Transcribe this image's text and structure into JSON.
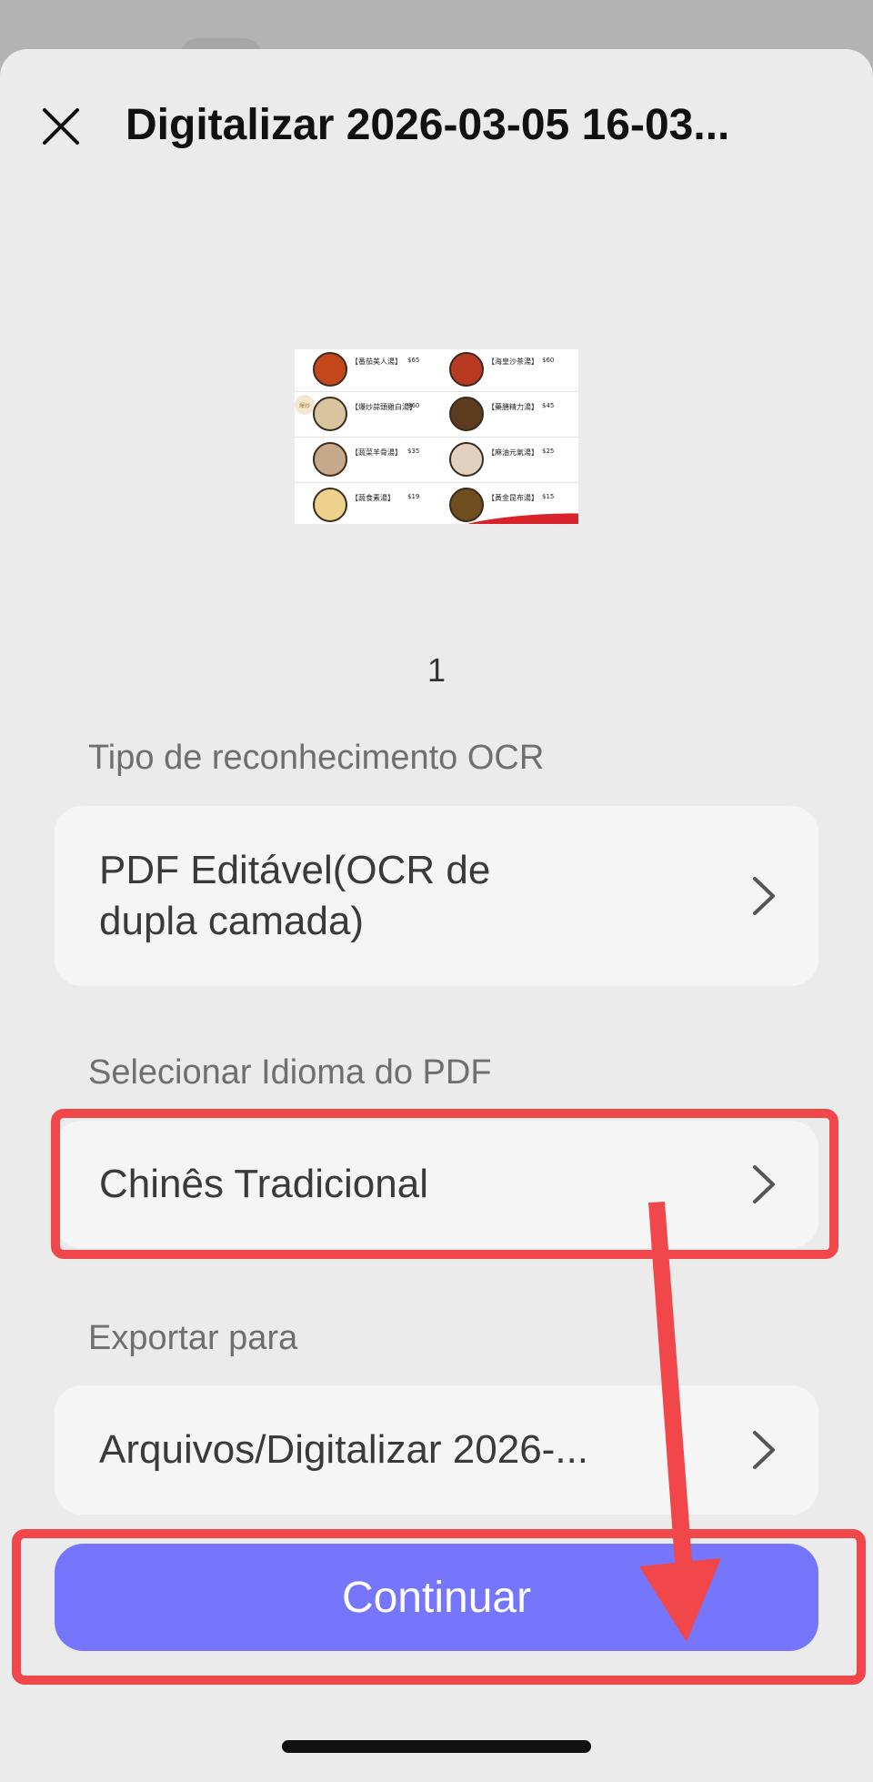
{
  "header": {
    "title": "Digitalizar 2026-03-05 16-03..."
  },
  "preview": {
    "page_number": "1",
    "menu_items": [
      {
        "name": "【番茄美人湯】",
        "price": "$65"
      },
      {
        "name": "【海皇沙茶湯】",
        "price": "$60"
      },
      {
        "name": "【爆炒蒜頭雞白湯】",
        "price": "$60"
      },
      {
        "name": "【藥膳精力湯】",
        "price": "$45"
      },
      {
        "name": "【蔬菜羊骨湯】",
        "price": "$35"
      },
      {
        "name": "【麻油元氣湯】",
        "price": "$25"
      },
      {
        "name": "【蔬食素湯】",
        "price": "$19"
      },
      {
        "name": "【黃金昆布湯】",
        "price": "$15"
      }
    ],
    "badge": "爆炒"
  },
  "ocr_type": {
    "label": "Tipo de reconhecimento OCR",
    "value_main": "PDF Editável",
    "value_extra": "(OCR de",
    "value_line2": "dupla camada)"
  },
  "language": {
    "label": "Selecionar Idioma do PDF",
    "value": "Chinês Tradicional"
  },
  "export": {
    "label": "Exportar para",
    "value": "Arquivos/Digitalizar 2026-..."
  },
  "actions": {
    "continue_label": "Continuar"
  },
  "colors": {
    "accent": "#7576fc",
    "annotation": "#f2474a"
  }
}
